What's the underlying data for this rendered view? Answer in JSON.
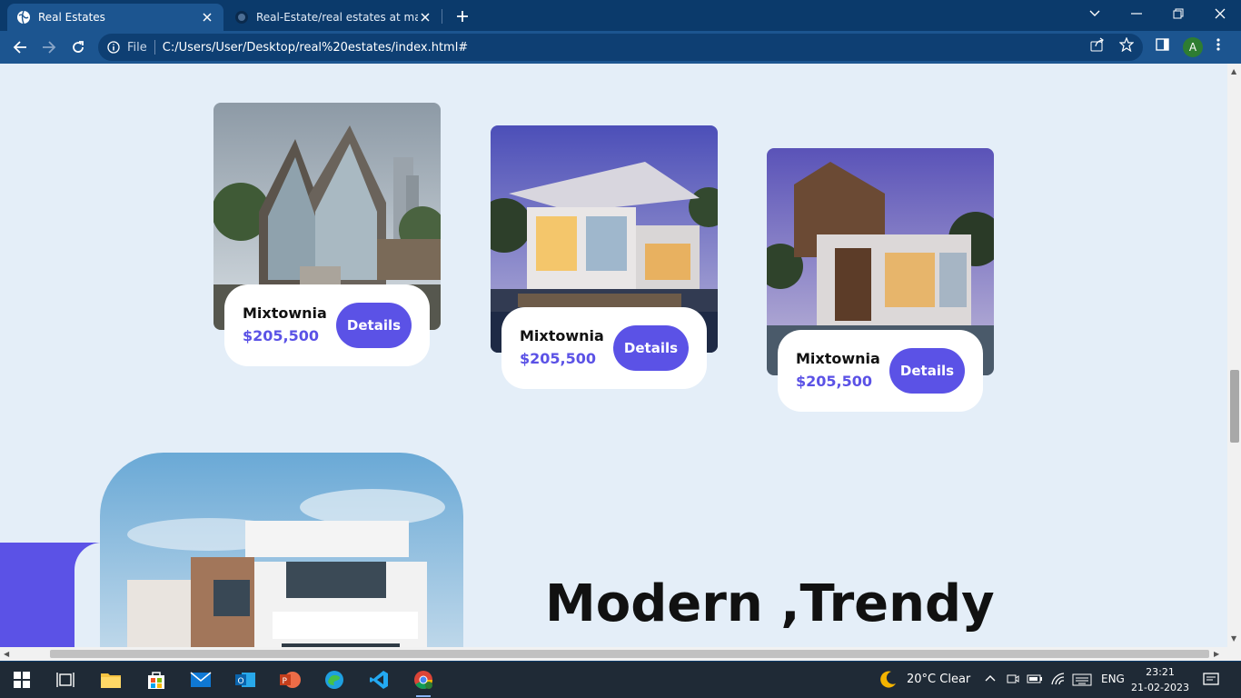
{
  "browser": {
    "tabs": [
      {
        "title": "Real Estates",
        "active": true
      },
      {
        "title": "Real-Estate/real estates at main · ",
        "active": false
      }
    ],
    "address": {
      "scheme_label": "File",
      "url": "C:/Users/User/Desktop/real%20estates/index.html#"
    },
    "profile_initial": "A"
  },
  "page": {
    "cards": [
      {
        "name": "Mixtownia",
        "price": "$205,500",
        "button": "Details"
      },
      {
        "name": "Mixtownia",
        "price": "$205,500",
        "button": "Details"
      },
      {
        "name": "Mixtownia",
        "price": "$205,500",
        "button": "Details"
      }
    ],
    "hero_heading": "Modern ,Trendy"
  },
  "taskbar": {
    "weather": "20°C  Clear",
    "language": "ENG",
    "time": "23:21",
    "date": "21-02-2023"
  },
  "colors": {
    "accent": "#5b52e6",
    "page_bg": "#e4eef8",
    "browser_frame": "#0b3a6b",
    "toolbar": "#1c5590"
  }
}
